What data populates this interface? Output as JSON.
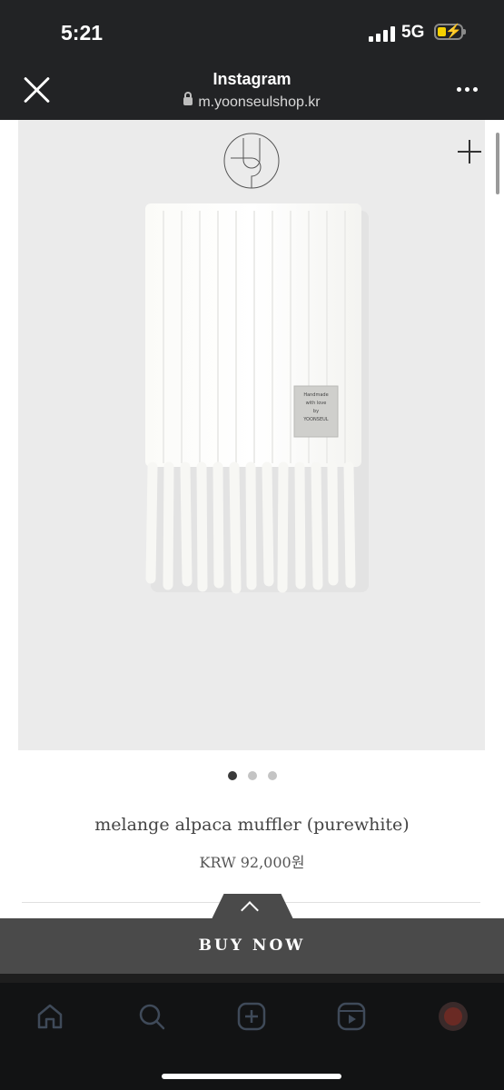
{
  "status_bar": {
    "time": "5:21",
    "network": "5G"
  },
  "browser": {
    "title": "Instagram",
    "url": "m.yoonseulshop.kr"
  },
  "product": {
    "name": "melange alpaca muffler (purewhite)",
    "price": "KRW 92,000원",
    "label_lines": [
      "Handmade",
      "with love",
      "by",
      "YOONSEUL"
    ]
  },
  "carousel": {
    "total": 3,
    "active": 1
  },
  "buy_now_label": "BUY NOW",
  "bottom_nav": [
    "home-icon",
    "search-icon",
    "create-icon",
    "reels-icon",
    "profile-avatar"
  ]
}
